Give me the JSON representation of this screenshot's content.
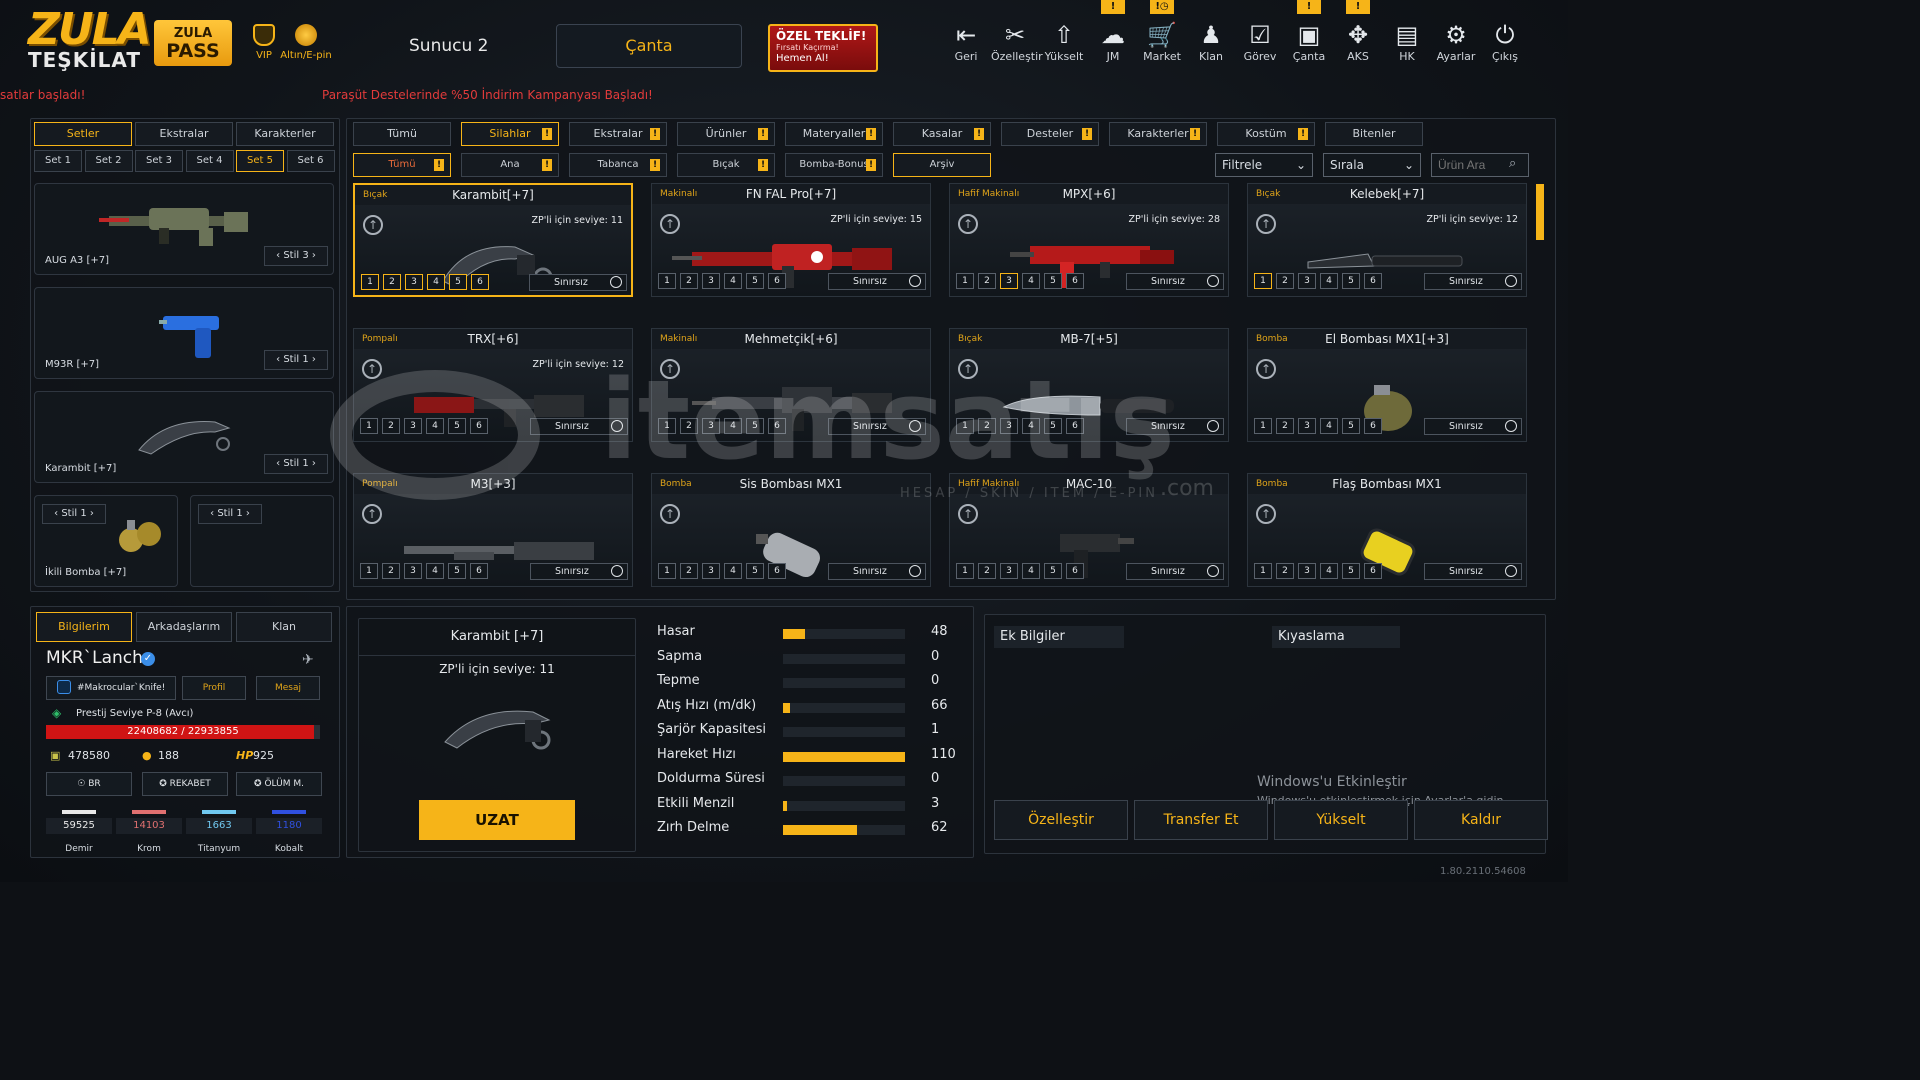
{
  "brand": {
    "logo_top": "ZULA",
    "logo_bottom": "TEŞKİLAT",
    "pass_top": "ZULA",
    "pass_bottom": "PASS",
    "vip": "VIP",
    "currency": "Altın/E-pin"
  },
  "server": "Sunucu 2",
  "canta_button": "Çanta",
  "offer": {
    "title": "ÖZEL TEKLİF!",
    "sub": "Fırsatı Kaçırma!",
    "cta": "Hemen Al!"
  },
  "top_icons": [
    {
      "label": "Geri",
      "icon": "back-icon",
      "glyph": "⇤",
      "notif": ""
    },
    {
      "label": "Özelleştir",
      "icon": "tools-icon",
      "glyph": "✂",
      "notif": ""
    },
    {
      "label": "Yükselt",
      "icon": "upgrade-icon",
      "glyph": "⇧",
      "notif": ""
    },
    {
      "label": "JM",
      "icon": "coins-icon",
      "glyph": "☁",
      "notif": "!"
    },
    {
      "label": "Market",
      "icon": "cart-icon",
      "glyph": "🛒",
      "notif": "!◷"
    },
    {
      "label": "Klan",
      "icon": "clan-icon",
      "glyph": "♟",
      "notif": ""
    },
    {
      "label": "Görev",
      "icon": "task-icon",
      "glyph": "☑",
      "notif": ""
    },
    {
      "label": "Çanta",
      "icon": "bag-icon",
      "glyph": "▣",
      "notif": "!"
    },
    {
      "label": "AKS",
      "icon": "aks-icon",
      "glyph": "✥",
      "notif": "!"
    },
    {
      "label": "HK",
      "icon": "wallet-icon",
      "glyph": "▤",
      "notif": ""
    },
    {
      "label": "Ayarlar",
      "icon": "gear-icon",
      "glyph": "⚙",
      "notif": ""
    },
    {
      "label": "Çıkış",
      "icon": "power-icon",
      "glyph": "⏻",
      "notif": ""
    }
  ],
  "ticker": {
    "left": "satlar başladı!",
    "main": "Paraşüt Destelerinde %50 İndirim Kampanyası Başladı!"
  },
  "left_tabs": [
    "Setler",
    "Ekstralar",
    "Karakterler"
  ],
  "set_tabs": [
    "Set 1",
    "Set 2",
    "Set 3",
    "Set 4",
    "Set 5",
    "Set 6"
  ],
  "sets": [
    {
      "name": "AUG A3 [+7]",
      "stil": "Stil 3"
    },
    {
      "name": "M93R [+7]",
      "stil": "Stil 1"
    },
    {
      "name": "Karambit [+7]",
      "stil": "Stil 1"
    },
    {
      "name": "İkili Bomba [+7]",
      "stil": "Stil 1"
    },
    {
      "name": "",
      "stil": "Stil 1"
    }
  ],
  "cat_tabs": [
    "Tümü",
    "Silahlar",
    "Ekstralar",
    "Ürünler",
    "Materyaller",
    "Kasalar",
    "Desteler",
    "Karakterler",
    "Kostüm",
    "Bitenler"
  ],
  "sub_tabs": [
    "Tümü",
    "Ana",
    "Tabanca",
    "Bıçak",
    "Bomba-Bonus",
    "Arşiv"
  ],
  "filters": {
    "filter": "Filtrele",
    "sort": "Sırala",
    "search_placeholder": "Ürün Ara"
  },
  "items": [
    {
      "cat": "Bıçak",
      "name": "Karambit[+7]",
      "zp": "ZP'li için seviye: 11",
      "icon": "karambit"
    },
    {
      "cat": "Makinalı",
      "name": "FN FAL Pro[+7]",
      "zp": "ZP'li için seviye: 15",
      "icon": "rifle-red"
    },
    {
      "cat": "Hafif Makinalı",
      "name": "MPX[+6]",
      "zp": "ZP'li için seviye: 28",
      "icon": "smg-red"
    },
    {
      "cat": "Bıçak",
      "name": "Kelebek[+7]",
      "zp": "ZP'li için seviye: 12",
      "icon": "butterfly"
    },
    {
      "cat": "Pompalı",
      "name": "TRX[+6]",
      "zp": "ZP'li için seviye: 12",
      "icon": "shotgun-red"
    },
    {
      "cat": "Makinalı",
      "name": "Mehmetçik[+6]",
      "zp": "",
      "icon": "rifle"
    },
    {
      "cat": "Bıçak",
      "name": "MB-7[+5]",
      "zp": "",
      "icon": "knife"
    },
    {
      "cat": "Bomba",
      "name": "El Bombası MX1[+3]",
      "zp": "",
      "icon": "grenade"
    },
    {
      "cat": "Pompalı",
      "name": "M3[+3]",
      "zp": "",
      "icon": "shotgun"
    },
    {
      "cat": "Bomba",
      "name": "Sis Bombası MX1",
      "zp": "",
      "icon": "smoke"
    },
    {
      "cat": "Hafif Makinalı",
      "name": "MAC-10",
      "zp": "",
      "icon": "mac10"
    },
    {
      "cat": "Bomba",
      "name": "Flaş Bombası MX1",
      "zp": "",
      "icon": "flash"
    }
  ],
  "levels": [
    "1",
    "2",
    "3",
    "4",
    "5",
    "6"
  ],
  "unlimited": "Sınırsız",
  "profile_tabs": [
    "Bilgilerim",
    "Arkadaşlarım",
    "Klan"
  ],
  "profile": {
    "name": "MKR`Lanch",
    "clan": "#Makrocular`Knife!",
    "profile_btn": "Profil",
    "message_btn": "Mesaj",
    "prestige": "Prestij Seviye P-8 (Avcı)",
    "xp": "22408682 / 22933855",
    "xp_fraction": 0.977,
    "zp": "478580",
    "gold": "188",
    "hp": "925",
    "modes": [
      "BR",
      "REKABET",
      "ÖLÜM M."
    ]
  },
  "materials": [
    {
      "label": "Demir",
      "value": "59525",
      "color": "#e8e8e8"
    },
    {
      "label": "Krom",
      "value": "14103",
      "color": "#e07070"
    },
    {
      "label": "Titanyum",
      "value": "1663",
      "color": "#70c8f0"
    },
    {
      "label": "Kobalt",
      "value": "1180",
      "color": "#3050e0"
    }
  ],
  "detail": {
    "name": "Karambit [+7]",
    "zp": "ZP'li için seviye: 11",
    "button": "UZAT"
  },
  "stats": [
    {
      "label": "Hasar",
      "value": "48",
      "fill": 0.18
    },
    {
      "label": "Sapma",
      "value": "0",
      "fill": 0
    },
    {
      "label": "Tepme",
      "value": "0",
      "fill": 0
    },
    {
      "label": "Atış Hızı (m/dk)",
      "value": "66",
      "fill": 0.06
    },
    {
      "label": "Şarjör Kapasitesi",
      "value": "1",
      "fill": 0
    },
    {
      "label": "Hareket Hızı",
      "value": "110",
      "fill": 1
    },
    {
      "label": "Doldurma Süresi",
      "value": "0",
      "fill": 0
    },
    {
      "label": "Etkili Menzil",
      "value": "3",
      "fill": 0.03
    },
    {
      "label": "Zırh Delme",
      "value": "62",
      "fill": 0.61
    }
  ],
  "extra": {
    "info": "Ek Bilgiler",
    "compare": "Kıyaslama",
    "win_title": "Windows'u Etkinleştir",
    "win_sub": "Windows'u etkinleştirmek için Ayarlar'a gidin."
  },
  "actions": [
    "Özelleştir",
    "Transfer Et",
    "Yükselt",
    "Kaldır"
  ],
  "version": "1.80.2110.54608",
  "watermark": {
    "main": "itemsatış",
    "sub": "HESAP / SKIN / ITEM / E-PIN",
    "com": ".com"
  },
  "colors": {
    "accent": "#f6b418",
    "alert": "#e23b3b"
  }
}
